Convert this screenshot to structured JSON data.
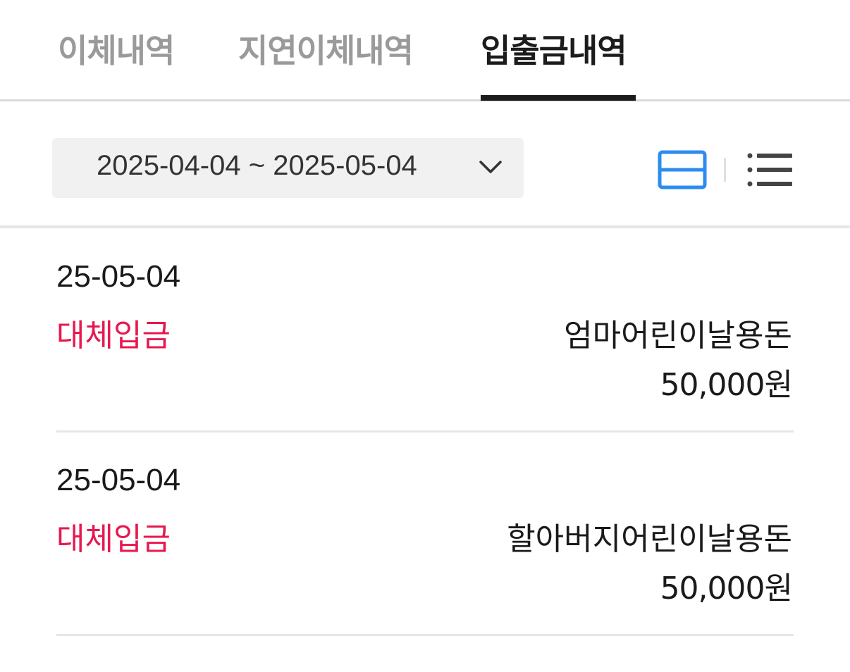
{
  "tabs": [
    {
      "label": "이체내역",
      "active": false
    },
    {
      "label": "지연이체내역",
      "active": false
    },
    {
      "label": "입출금내역",
      "active": true
    }
  ],
  "filter": {
    "date_range": "2025-04-04 ~ 2025-05-04",
    "dropdown_icon": "chevron-down-icon",
    "view_modes": [
      {
        "icon": "card-view-icon",
        "active": true,
        "color": "#2d8cf0"
      },
      {
        "icon": "list-view-icon",
        "active": false,
        "color": "#444444"
      }
    ]
  },
  "transactions": [
    {
      "date": "25-05-04",
      "type": "대체입금",
      "memo": "엄마어린이날용돈",
      "amount": "50,000원"
    },
    {
      "date": "25-05-04",
      "type": "대체입금",
      "memo": "할아버지어린이날용돈",
      "amount": "50,000원"
    }
  ],
  "colors": {
    "accent_red": "#e8184f",
    "accent_blue": "#2d8cf0",
    "active_tab": "#1c1c1c",
    "inactive_tab": "#9a9a9a"
  }
}
